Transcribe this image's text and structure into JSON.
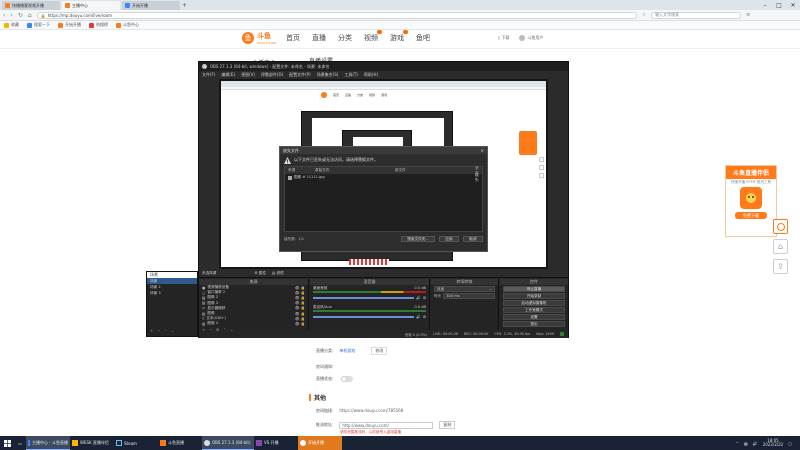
{
  "browser": {
    "tabs": [
      {
        "label": "快播播客视频开播"
      },
      {
        "label": "主播中心"
      },
      {
        "label": "开始开播"
      }
    ],
    "url": "https://mp.douyu.com/live/room",
    "search_placeholder": "输入文字搜索",
    "bookmarks": [
      "收藏",
      "搜索一下",
      "开始开播",
      "热搜榜",
      "斗鱼中心"
    ]
  },
  "site": {
    "logo_text": "斗鱼",
    "logo_sub": "DOUYU.COM",
    "nav": [
      "首页",
      "直播",
      "分类",
      "视频",
      "游戏",
      "鱼吧"
    ],
    "user_download": "下载",
    "user_name": "斗鱼用户",
    "side_title": "主播中心",
    "page_title": "直播设置",
    "promo_title": "斗鱼直播伴侣",
    "promo_sub": "快速开播 RTMP 推流工具",
    "promo_button": "免费下载",
    "form": {
      "label1": "直播分类:",
      "value1": "单机游戏",
      "btn1": "修改",
      "label2": "房间通知:",
      "label3": "直播状态:",
      "section": "其他",
      "label4": "房间链接:",
      "value4": "https://www.douyu.com/785568",
      "label5": "推流地址:",
      "value5": "http://www.douyu.com/",
      "btn5": "复制",
      "warn": "请勿泄露推流码，以防被他人盗用直播"
    }
  },
  "obs": {
    "title": "OBS 27.1.3 (64-bit, windows) - 配置文件: 未命名 - 场景: 未命名",
    "menu": [
      "文件(F)",
      "编辑(E)",
      "视图(V)",
      "停靠部件(D)",
      "配置文件(P)",
      "场景集合(S)",
      "工具(T)",
      "帮助(H)"
    ],
    "dialog": {
      "title": "缺失文件",
      "message": "以下文件已丢失或无法访问，请选择替换文件。",
      "columns": [
        "来源",
        "原始文件",
        "新文件",
        "状态"
      ],
      "row": {
        "source": "图像 # 11111.jpg",
        "orig": "",
        "new": "",
        "status": "缺失"
      },
      "found": "缺失数：1/1",
      "btn_search": "搜索文件夹...",
      "btn_apply": "应用",
      "btn_cancel": "取消"
    },
    "preview_site_nav": [
      "首页",
      "直播",
      "分类",
      "视频",
      "游戏"
    ],
    "no_source": "未选择源",
    "props_btn": "属性",
    "filters_btn": "滤镜",
    "scenes_title": "场景",
    "scenes": [
      "场景",
      "场景 2",
      "场景 3"
    ],
    "sources_title": "来源",
    "sources": [
      "视频捕获设备",
      "窗口捕获 2",
      "图像 2",
      "图像 3",
      "显示器捕获",
      "图像",
      "文本(GDI+)",
      "图像 4"
    ],
    "mixer_title": "混音器",
    "mixer": [
      {
        "name": "桌面音频",
        "db": "0.0 dB"
      },
      {
        "name": "麦克风/Aux",
        "db": "0.0 dB"
      }
    ],
    "transitions_title": "转场特效",
    "transition": "淡出",
    "duration_label": "时长",
    "duration": "300 ms",
    "controls_title": "控件",
    "controls": [
      "停止直播",
      "开始录制",
      "启动虚拟摄像机",
      "工作室模式",
      "设置",
      "退出"
    ],
    "status": {
      "dropped": "丢帧 0 (0.0%)",
      "live": "LIVE: 00:00:36",
      "rec": "REC: 00:00:00",
      "cpu": "CPU: 3.3%, 30.00 fps",
      "kbps": "kb/s: 2499"
    }
  },
  "taskbar": {
    "items": [
      "主播中心 - 斗鱼直播",
      "WESK 直播伴侣",
      "Steam",
      "斗鱼直播",
      "OBS 27.1.3 (64-bit)",
      "VS 开播",
      "开始开播"
    ],
    "time": "18:05",
    "date": "2022/2/22"
  },
  "colors": {
    "douyu_orange": "#ff7a1a",
    "obs_bg": "#2b2b2b",
    "taskbar_bg": "#1a2335",
    "link_blue": "#2f6fd0"
  }
}
